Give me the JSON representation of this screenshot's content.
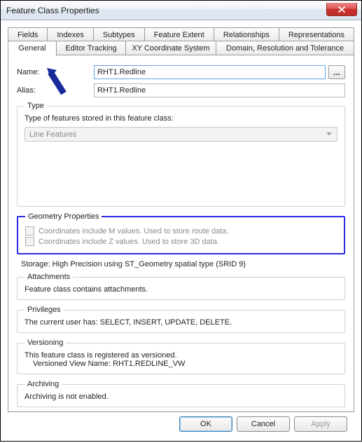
{
  "window": {
    "title": "Feature Class Properties"
  },
  "tabs": {
    "back": [
      "Fields",
      "Indexes",
      "Subtypes",
      "Feature Extent",
      "Relationships",
      "Representations"
    ],
    "front": [
      "General",
      "Editor Tracking",
      "XY Coordinate System",
      "Domain, Resolution and Tolerance"
    ],
    "active": "General"
  },
  "general": {
    "name_label": "Name:",
    "name_value": "RHT1.Redline",
    "alias_label": "Alias:",
    "alias_value": "RHT1.Redline",
    "browse_label": "..."
  },
  "type": {
    "legend": "Type",
    "prompt": "Type of features stored in this feature class:",
    "selected": "Line Features"
  },
  "geometry": {
    "legend": "Geometry Properties",
    "m_label": "Coordinates include M values. Used to store route data.",
    "z_label": "Coordinates include Z values. Used to store 3D data."
  },
  "storage_line": "Storage: High Precision using ST_Geometry spatial type (SRID 9)",
  "attachments": {
    "legend": "Attachments",
    "text": "Feature class contains attachments."
  },
  "privileges": {
    "legend": "Privileges",
    "text": "The current user has: SELECT, INSERT, UPDATE, DELETE."
  },
  "versioning": {
    "legend": "Versioning",
    "line1": "This feature class is registered as versioned.",
    "line2": "Versioned View Name: RHT1.REDLINE_VW"
  },
  "archiving": {
    "legend": "Archiving",
    "text": "Archiving is not enabled."
  },
  "buttons": {
    "ok": "OK",
    "cancel": "Cancel",
    "apply": "Apply"
  }
}
